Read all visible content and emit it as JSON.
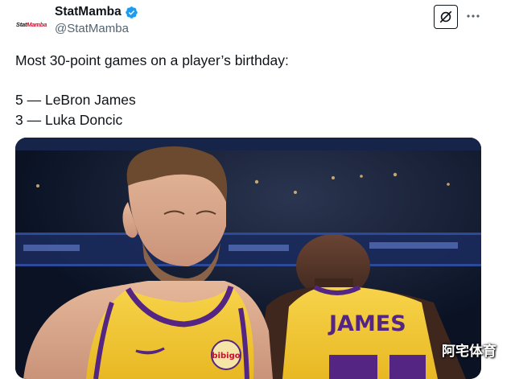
{
  "author": {
    "display_name": "StatMamba",
    "handle": "@StatMamba",
    "avatar_text": "StatMamba",
    "verified": true
  },
  "tweet": {
    "lines": [
      "Most 30-point games on a player’s birthday:",
      "",
      "5 — LeBron James",
      "3 — Luka Doncic"
    ]
  },
  "media": {
    "jersey_name": "JAMES",
    "sponsor_patch": "bibigo"
  },
  "icons": {
    "verified": "verified-badge-icon",
    "grok": "grok-icon",
    "more": "more-horizontal-icon"
  },
  "colors": {
    "verified_blue": "#1d9bf0",
    "lakers_gold": "#f5c931",
    "lakers_purple": "#552583"
  },
  "watermark": "阿宅体育"
}
